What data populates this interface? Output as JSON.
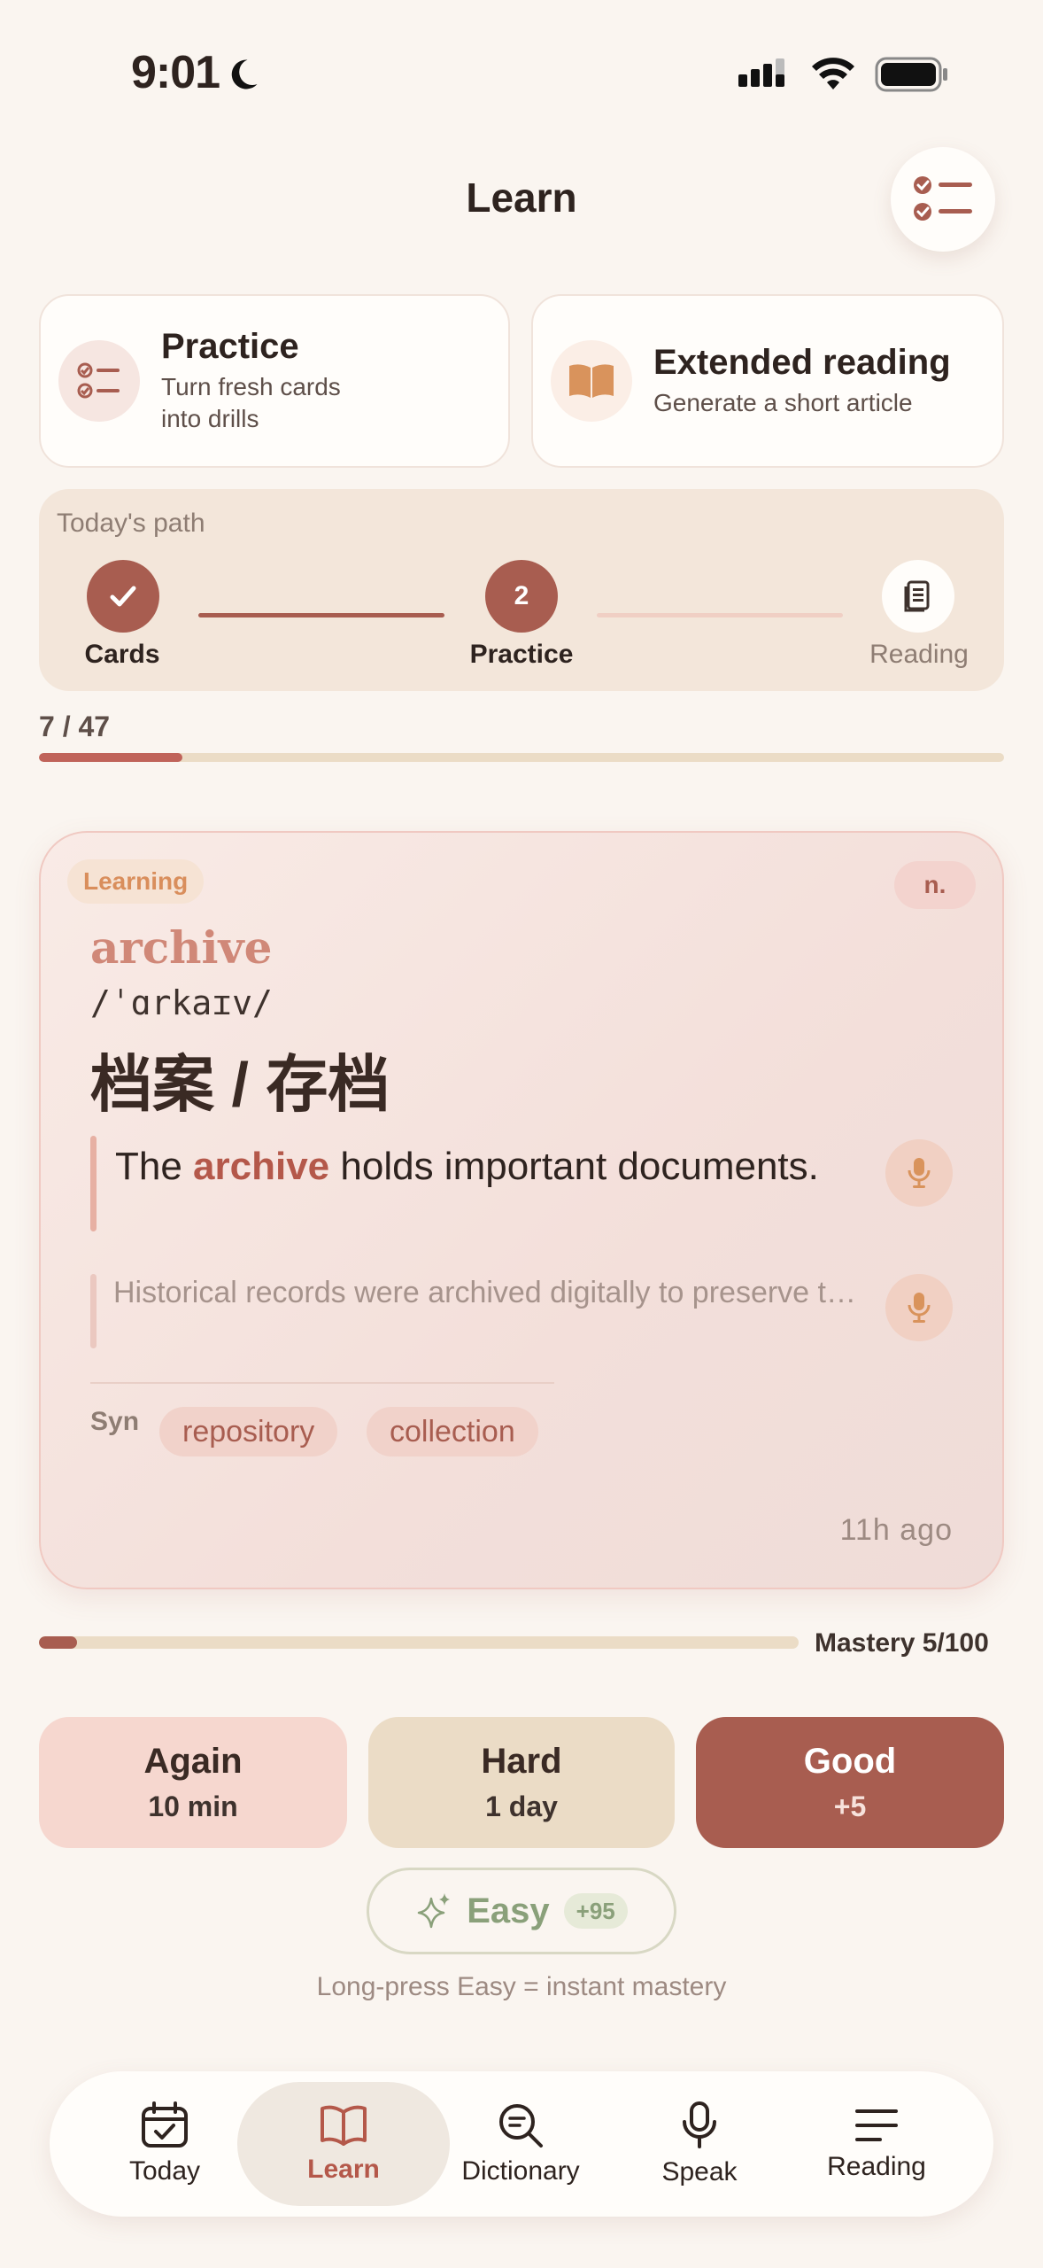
{
  "status_bar": {
    "time": "9:01"
  },
  "header": {
    "title": "Learn"
  },
  "top_cards": {
    "practice": {
      "title": "Practice",
      "subtitle_line1": "Turn fresh cards",
      "subtitle_line2": "into drills"
    },
    "reading": {
      "title": "Extended reading",
      "subtitle": "Generate a short article"
    }
  },
  "path": {
    "label": "Today's path",
    "steps": [
      {
        "label": "Cards",
        "state": "done"
      },
      {
        "label": "Practice",
        "number": "2",
        "state": "current"
      },
      {
        "label": "Reading",
        "state": "upcoming"
      }
    ]
  },
  "progress": {
    "text": "7 / 47",
    "fraction": 0.149
  },
  "card": {
    "status": "Learning",
    "pos": "n.",
    "word": "archive",
    "phonetic": "/ˈɑrkaɪv/",
    "translation": "档案 / 存档",
    "example_pre": "The ",
    "example_word": "archive",
    "example_post": " holds important documents.",
    "example2": "Historical records were archived digitally to preserve them.",
    "syn_label": "Syn",
    "synonyms": [
      "repository",
      "collection"
    ],
    "ago": "11h  ago"
  },
  "mastery": {
    "label": "Mastery 5/100",
    "fraction": 0.05
  },
  "answers": {
    "again": {
      "title": "Again",
      "sub": "10 min"
    },
    "hard": {
      "title": "Hard",
      "sub": "1 day"
    },
    "good": {
      "title": "Good",
      "sub": "+5"
    },
    "easy": {
      "title": "Easy",
      "points": "+95"
    }
  },
  "hint": "Long-press Easy = instant mastery",
  "nav": [
    {
      "label": "Today",
      "icon": "calendar-check-icon"
    },
    {
      "label": "Learn",
      "icon": "book-open-icon",
      "active": true
    },
    {
      "label": "Dictionary",
      "icon": "search-icon"
    },
    {
      "label": "Speak",
      "icon": "microphone-icon"
    },
    {
      "label": "Reading",
      "icon": "lines-icon"
    }
  ],
  "colors": {
    "accent": "#a85d50",
    "background": "#faf5f0",
    "easy": "#8aa07a"
  }
}
